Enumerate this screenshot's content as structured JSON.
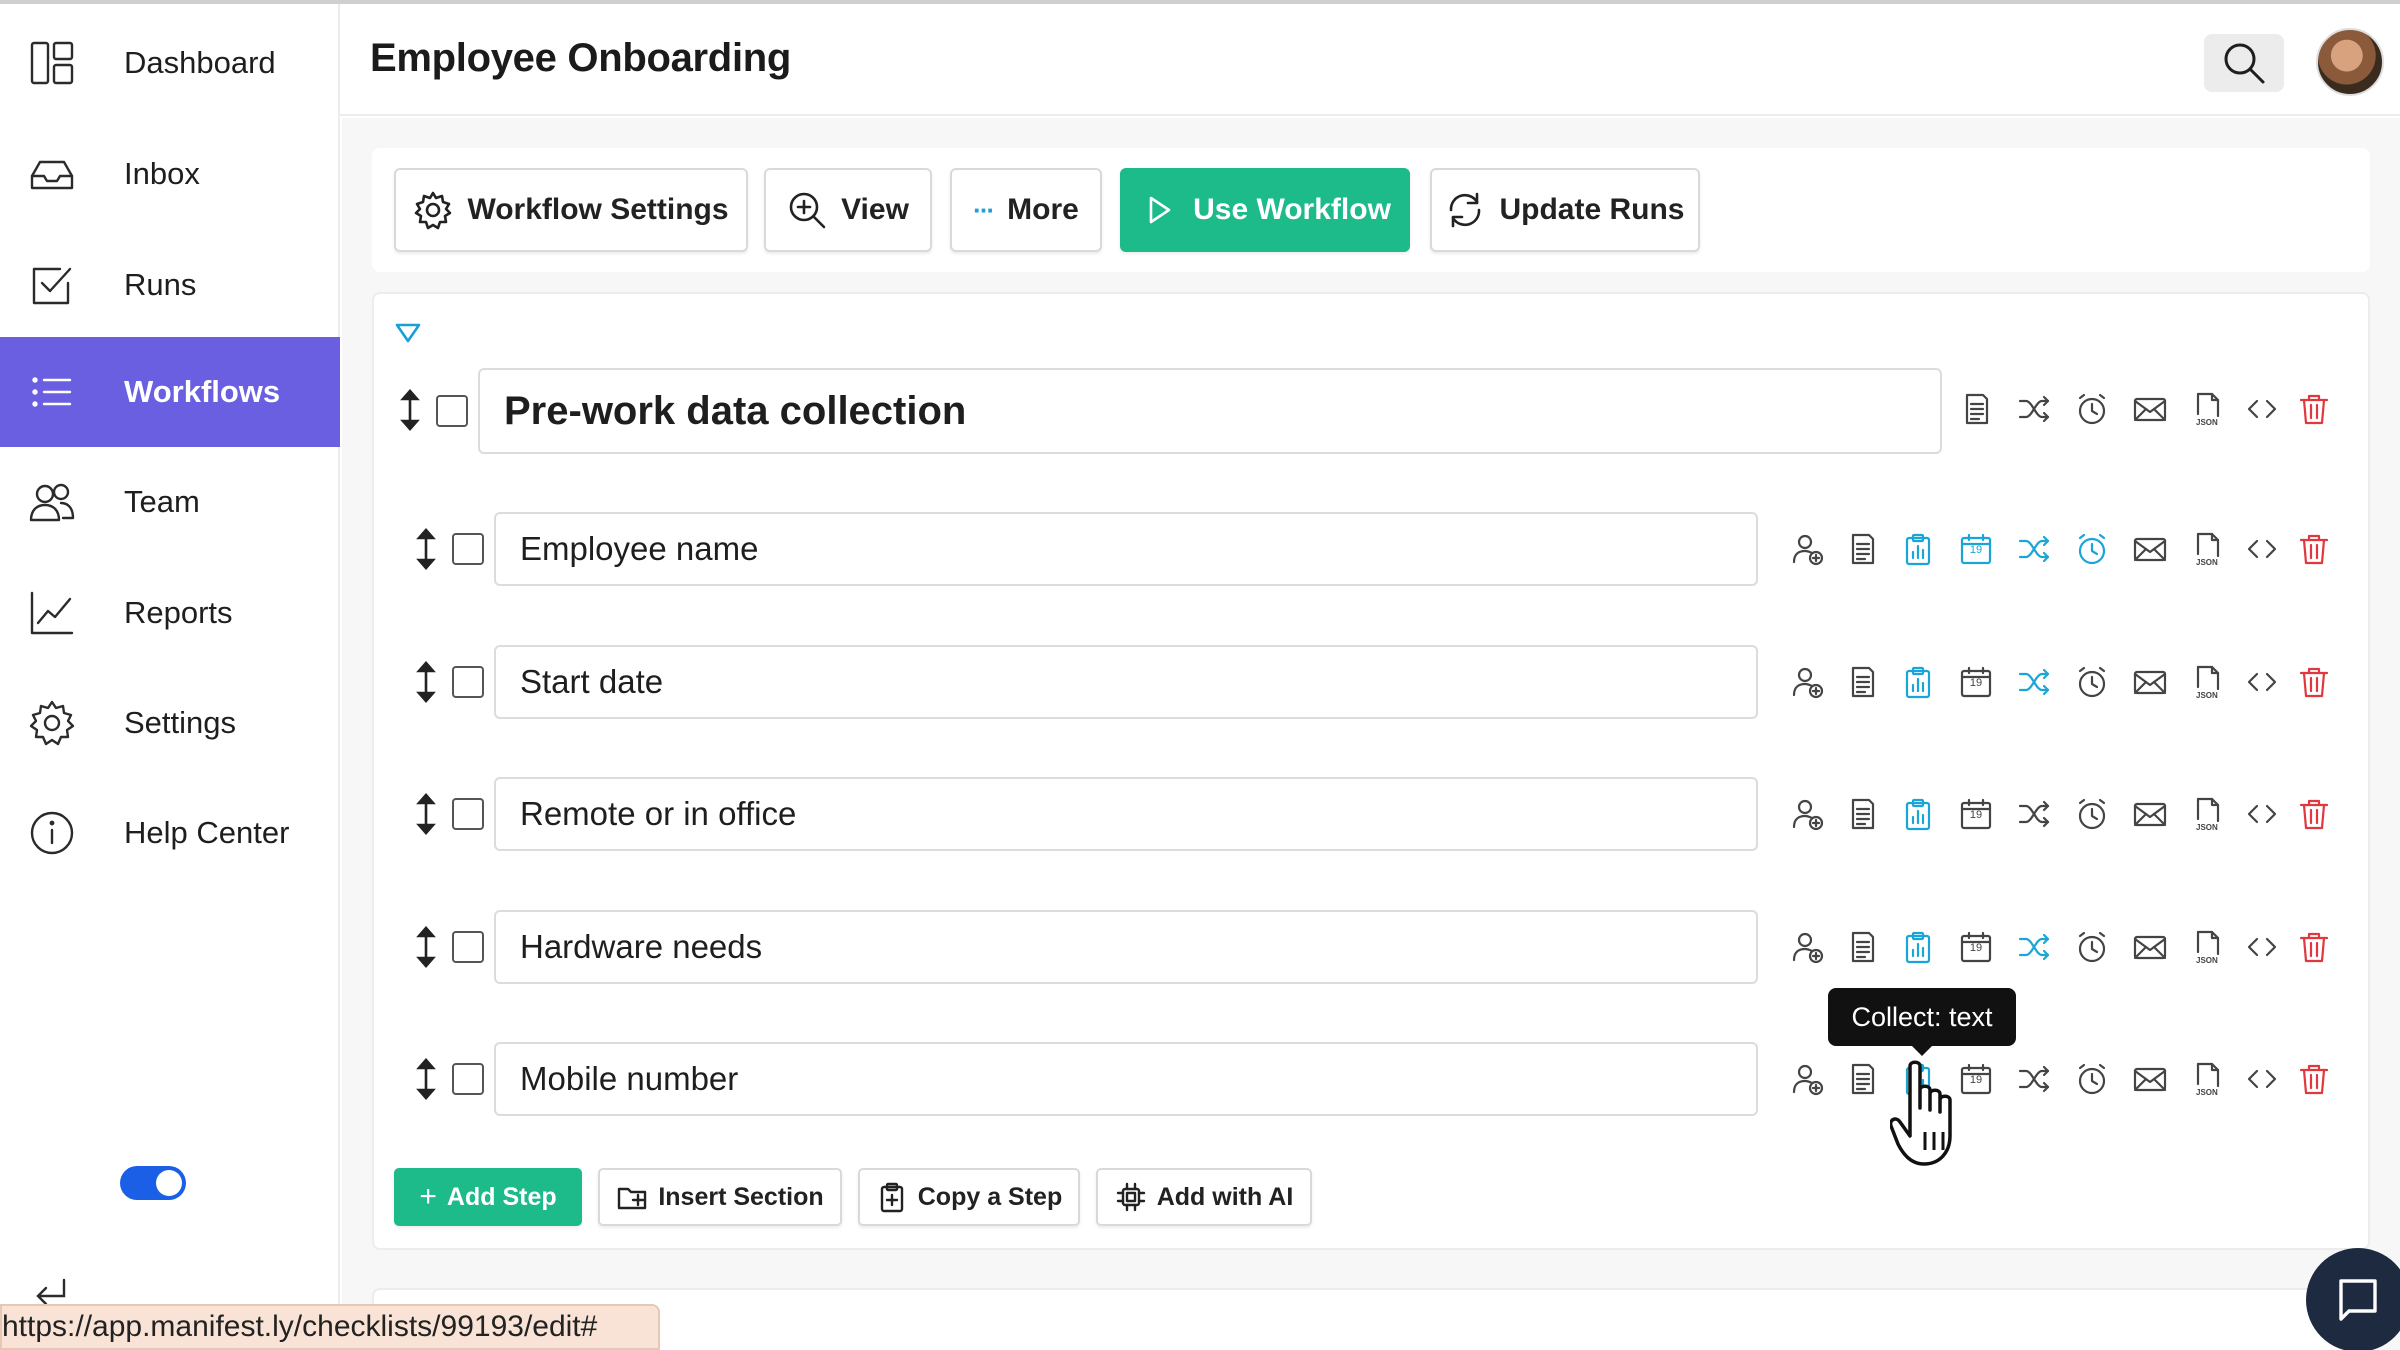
{
  "app": {
    "page_title": "Employee Onboarding"
  },
  "sidebar": {
    "items": [
      {
        "label": "Dashboard",
        "icon": "dashboard-icon"
      },
      {
        "label": "Inbox",
        "icon": "inbox-icon"
      },
      {
        "label": "Runs",
        "icon": "checkbox-icon"
      },
      {
        "label": "Workflows",
        "icon": "list-icon",
        "active": true
      },
      {
        "label": "Team",
        "icon": "team-icon"
      },
      {
        "label": "Reports",
        "icon": "chart-line-icon"
      },
      {
        "label": "Settings",
        "icon": "gear-icon"
      },
      {
        "label": "Help Center",
        "icon": "info-icon"
      }
    ],
    "toggle_on": true
  },
  "toolbar": {
    "workflow_settings": "Workflow Settings",
    "view": "View",
    "more": "More",
    "use_workflow": "Use Workflow",
    "update_runs": "Update Runs"
  },
  "section": {
    "title": "Pre-work data collection"
  },
  "steps": [
    {
      "label": "Employee name"
    },
    {
      "label": "Start date"
    },
    {
      "label": "Remote or in office"
    },
    {
      "label": "Hardware needs"
    },
    {
      "label": "Mobile number"
    }
  ],
  "bottom_actions": {
    "add_step": "Add Step",
    "insert_section": "Insert Section",
    "copy_step": "Copy a Step",
    "add_ai": "Add with AI"
  },
  "tooltip": {
    "text": "Collect: text"
  },
  "status_bar": {
    "url": "https://app.manifest.ly/checklists/99193/edit#"
  },
  "icon_labels": {
    "json": "JSON",
    "calendar_day": "19"
  },
  "colors": {
    "accent": "#6a5fe0",
    "primary_green": "#1dba8a",
    "icon_blue": "#1aa5d8",
    "delete_red": "#e0383e",
    "toggle_blue": "#1b5fe6"
  }
}
